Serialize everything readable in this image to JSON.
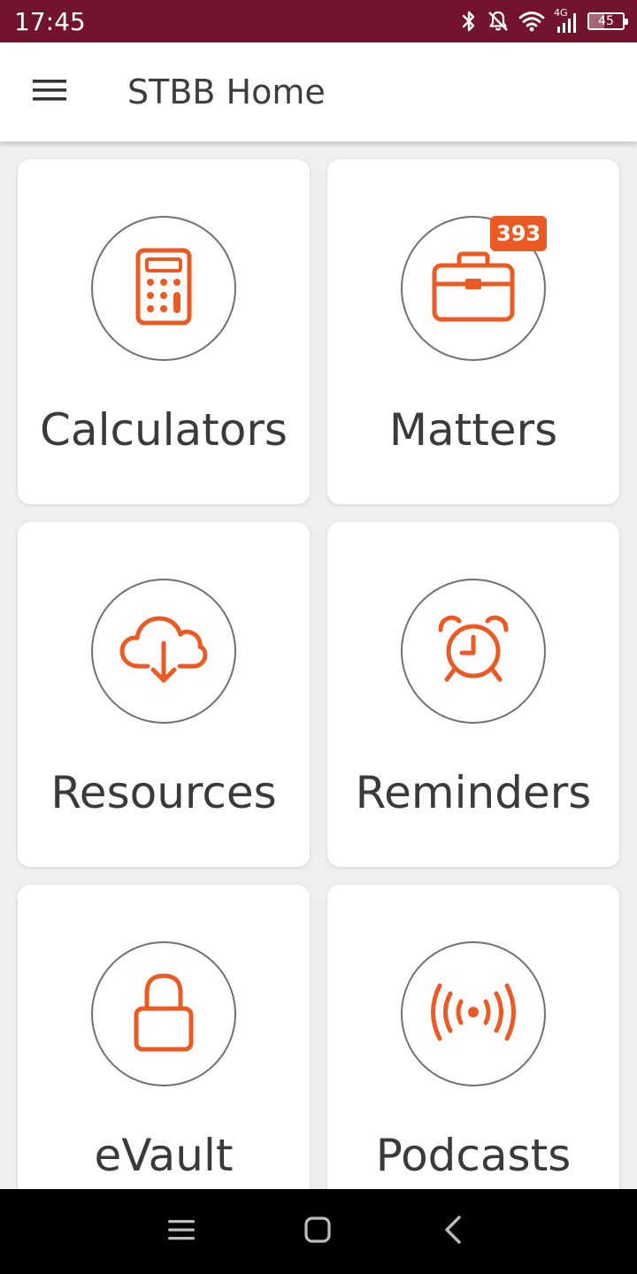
{
  "status_bar": {
    "time": "17:45",
    "battery_text": "45",
    "battery_level_percent": 45,
    "network_label": "4G",
    "icons": [
      "bluetooth-icon",
      "do-not-disturb-icon",
      "wifi-icon",
      "signal-icon",
      "battery-icon"
    ],
    "background": "#73142e"
  },
  "app_bar": {
    "title": "STBB Home",
    "menu_icon": "hamburger-menu-icon"
  },
  "accent_color": "#ec5a24",
  "tiles": [
    {
      "label": "Calculators",
      "icon": "calculator-icon"
    },
    {
      "label": "Matters",
      "icon": "briefcase-icon",
      "badge": "393"
    },
    {
      "label": "Resources",
      "icon": "cloud-download-icon"
    },
    {
      "label": "Reminders",
      "icon": "alarm-clock-icon"
    },
    {
      "label": "eVault",
      "icon": "lock-icon"
    },
    {
      "label": "Podcasts",
      "icon": "broadcast-icon"
    }
  ],
  "nav_bar": {
    "buttons": [
      "menu-icon",
      "home-icon",
      "back-icon"
    ]
  }
}
